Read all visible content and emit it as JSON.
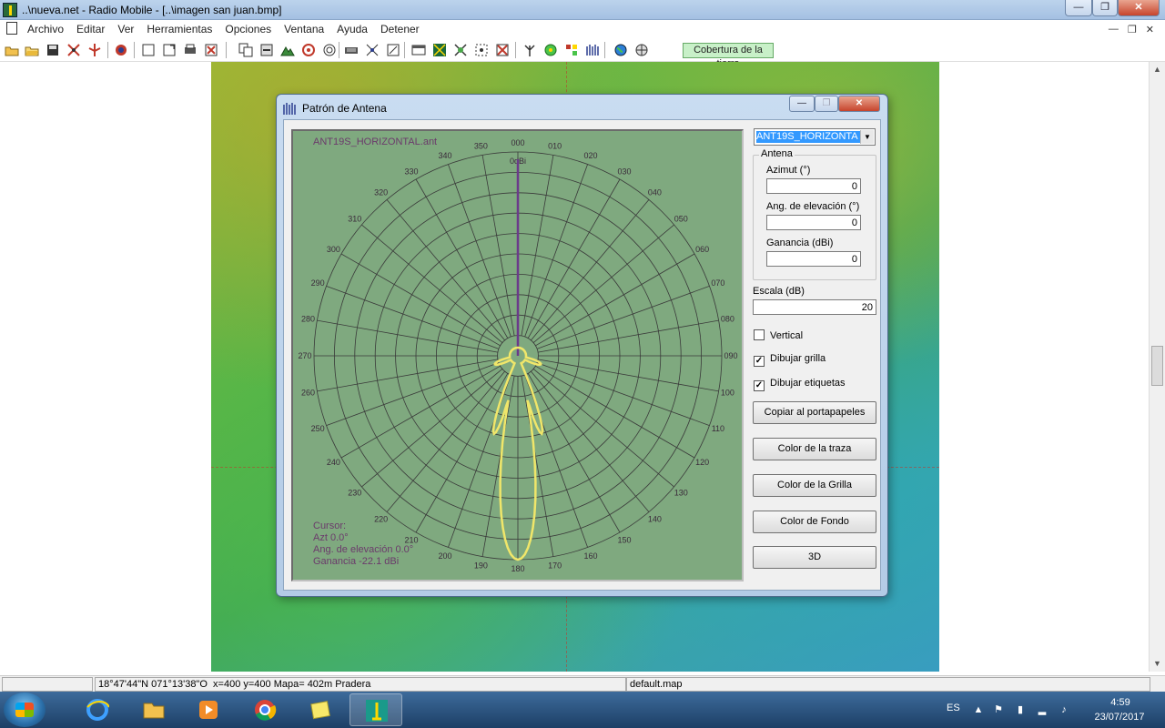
{
  "window": {
    "title": "..\\nueva.net - Radio Mobile - [..\\imagen san juan.bmp]",
    "minimize": "—",
    "maximize": "❐",
    "close": "✕"
  },
  "menu": {
    "items": [
      "Archivo",
      "Editar",
      "Ver",
      "Herramientas",
      "Opciones",
      "Ventana",
      "Ayuda",
      "Detener"
    ],
    "mdi_minimize": "—",
    "mdi_restore": "❐",
    "mdi_close": "✕"
  },
  "toolbar": {
    "coverage_label": "Cobertura de la tierra"
  },
  "status": {
    "coords": "18°47'44\"N  071°13'38\"O",
    "info": "x=400 y=400 Mapa= 402m Pradera",
    "map_file": "default.map"
  },
  "taskbar": {
    "language": "ES",
    "time": "4:59",
    "date": "23/07/2017"
  },
  "dialog": {
    "title": "Patrón de Antena",
    "minimize": "—",
    "maximize": "❐",
    "close": "✕",
    "plot": {
      "antenna_file": "ANT19S_HORIZONTAL.ant",
      "zero_label": "0dBi",
      "angle_labels": [
        "000",
        "010",
        "020",
        "030",
        "040",
        "050",
        "060",
        "070",
        "080",
        "090",
        "100",
        "110",
        "120",
        "130",
        "140",
        "150",
        "160",
        "170",
        "180",
        "190",
        "200",
        "210",
        "220",
        "230",
        "240",
        "250",
        "260",
        "270",
        "280",
        "290",
        "300",
        "310",
        "320",
        "330",
        "340",
        "350"
      ],
      "cursor_header": "Cursor:",
      "cursor_azimuth": "Azt 0.0°",
      "cursor_elevation": "Ang. de elevación 0.0°",
      "cursor_gain": "Ganancia -22.1 dBi",
      "trace_color": "#f0e66a",
      "grid_color": "#3a3a3a",
      "background_color": "#7fa97f"
    },
    "side": {
      "antenna_selected": "ANT19S_HORIZONTA",
      "group_title": "Antena",
      "azimuth_label": "Azimut (°)",
      "azimuth_value": "0",
      "elevation_label": "Ang. de elevación (°)",
      "elevation_value": "0",
      "gain_label": "Ganancia (dBi)",
      "gain_value": "0",
      "scale_label": "Escala (dB)",
      "scale_value": "20",
      "vertical_label": "Vertical",
      "vertical_checked": false,
      "grid_label": "Dibujar grilla",
      "grid_checked": true,
      "labels_label": "Dibujar etiquetas",
      "labels_checked": true,
      "copy_button": "Copiar al portapapeles",
      "trace_color_button": "Color de la traza",
      "grid_color_button": "Color de la Grilla",
      "bg_color_button": "Color de Fondo",
      "3d_button": "3D"
    }
  }
}
